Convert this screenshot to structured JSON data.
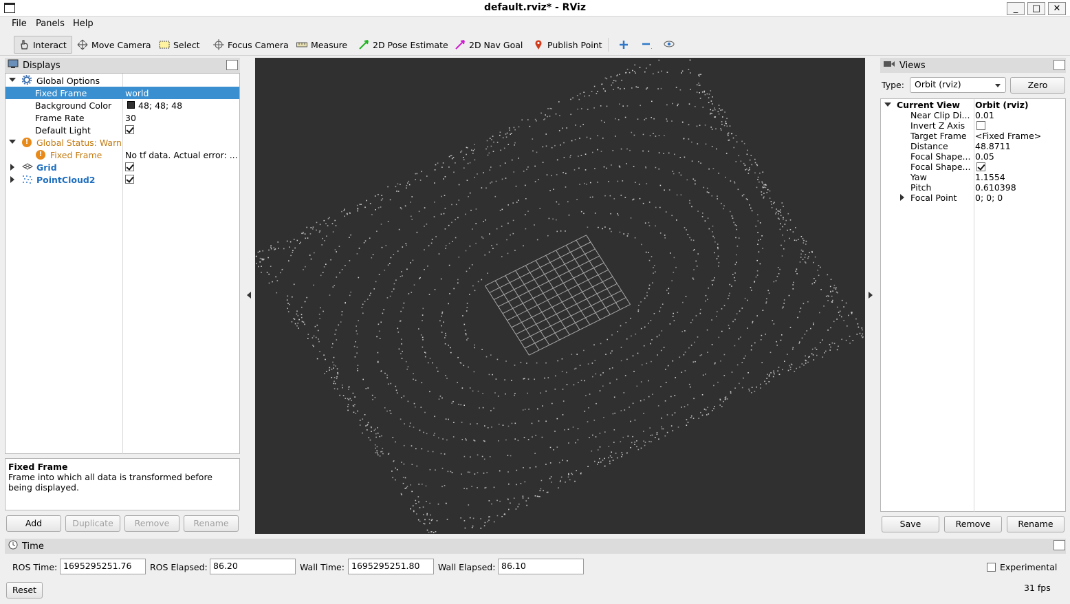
{
  "window": {
    "title": "default.rviz* - RViz",
    "minimize": "_",
    "maximize": "□",
    "close": "✕"
  },
  "menu": {
    "file": "File",
    "panels": "Panels",
    "help": "Help"
  },
  "toolbar": {
    "interact": "Interact",
    "move_camera": "Move Camera",
    "select": "Select",
    "focus_camera": "Focus Camera",
    "measure": "Measure",
    "pose_estimate": "2D Pose Estimate",
    "nav_goal": "2D Nav Goal",
    "publish_point": "Publish Point"
  },
  "displays": {
    "title": "Displays",
    "global_options": "Global Options",
    "fixed_frame_label": "Fixed Frame",
    "fixed_frame_value": "world",
    "bg_color_label": "Background Color",
    "bg_color_value": "48; 48; 48",
    "bg_color_swatch": "#303030",
    "frame_rate_label": "Frame Rate",
    "frame_rate_value": "30",
    "default_light_label": "Default Light",
    "global_status": "Global Status: Warn",
    "status_fixed_frame": "Fixed Frame",
    "status_fixed_frame_value": "No tf data.  Actual error: ...",
    "grid": "Grid",
    "pointcloud": "PointCloud2",
    "desc_title": "Fixed Frame",
    "desc_text": "Frame into which all data is transformed before being displayed.",
    "btn_add": "Add",
    "btn_duplicate": "Duplicate",
    "btn_remove": "Remove",
    "btn_rename": "Rename"
  },
  "views": {
    "title": "Views",
    "type_label": "Type:",
    "type_value": "Orbit (rviz)",
    "zero": "Zero",
    "current_view": "Current View",
    "current_view_value": "Orbit (rviz)",
    "rows": [
      {
        "label": "Near Clip Di...",
        "value": "0.01"
      },
      {
        "label": "Invert Z Axis",
        "value": ""
      },
      {
        "label": "Target Frame",
        "value": "<Fixed Frame>"
      },
      {
        "label": "Distance",
        "value": "48.8711"
      },
      {
        "label": "Focal Shape...",
        "value": "0.05"
      },
      {
        "label": "Focal Shape...",
        "value": ""
      },
      {
        "label": "Yaw",
        "value": "1.1554"
      },
      {
        "label": "Pitch",
        "value": "0.610398"
      },
      {
        "label": "Focal Point",
        "value": "0; 0; 0"
      }
    ],
    "btn_save": "Save",
    "btn_remove": "Remove",
    "btn_rename": "Rename"
  },
  "time": {
    "title": "Time",
    "ros_time_label": "ROS Time:",
    "ros_time": "1695295251.76",
    "ros_elapsed_label": "ROS Elapsed:",
    "ros_elapsed": "86.20",
    "wall_time_label": "Wall Time:",
    "wall_time": "1695295251.80",
    "wall_elapsed_label": "Wall Elapsed:",
    "wall_elapsed": "86.10",
    "experimental": "Experimental",
    "reset": "Reset",
    "fps": "31 fps"
  },
  "colors": {
    "selection": "#3a8fd0",
    "warn": "#e88a1a",
    "link": "#1f6fbf",
    "viewport": "#303030"
  }
}
